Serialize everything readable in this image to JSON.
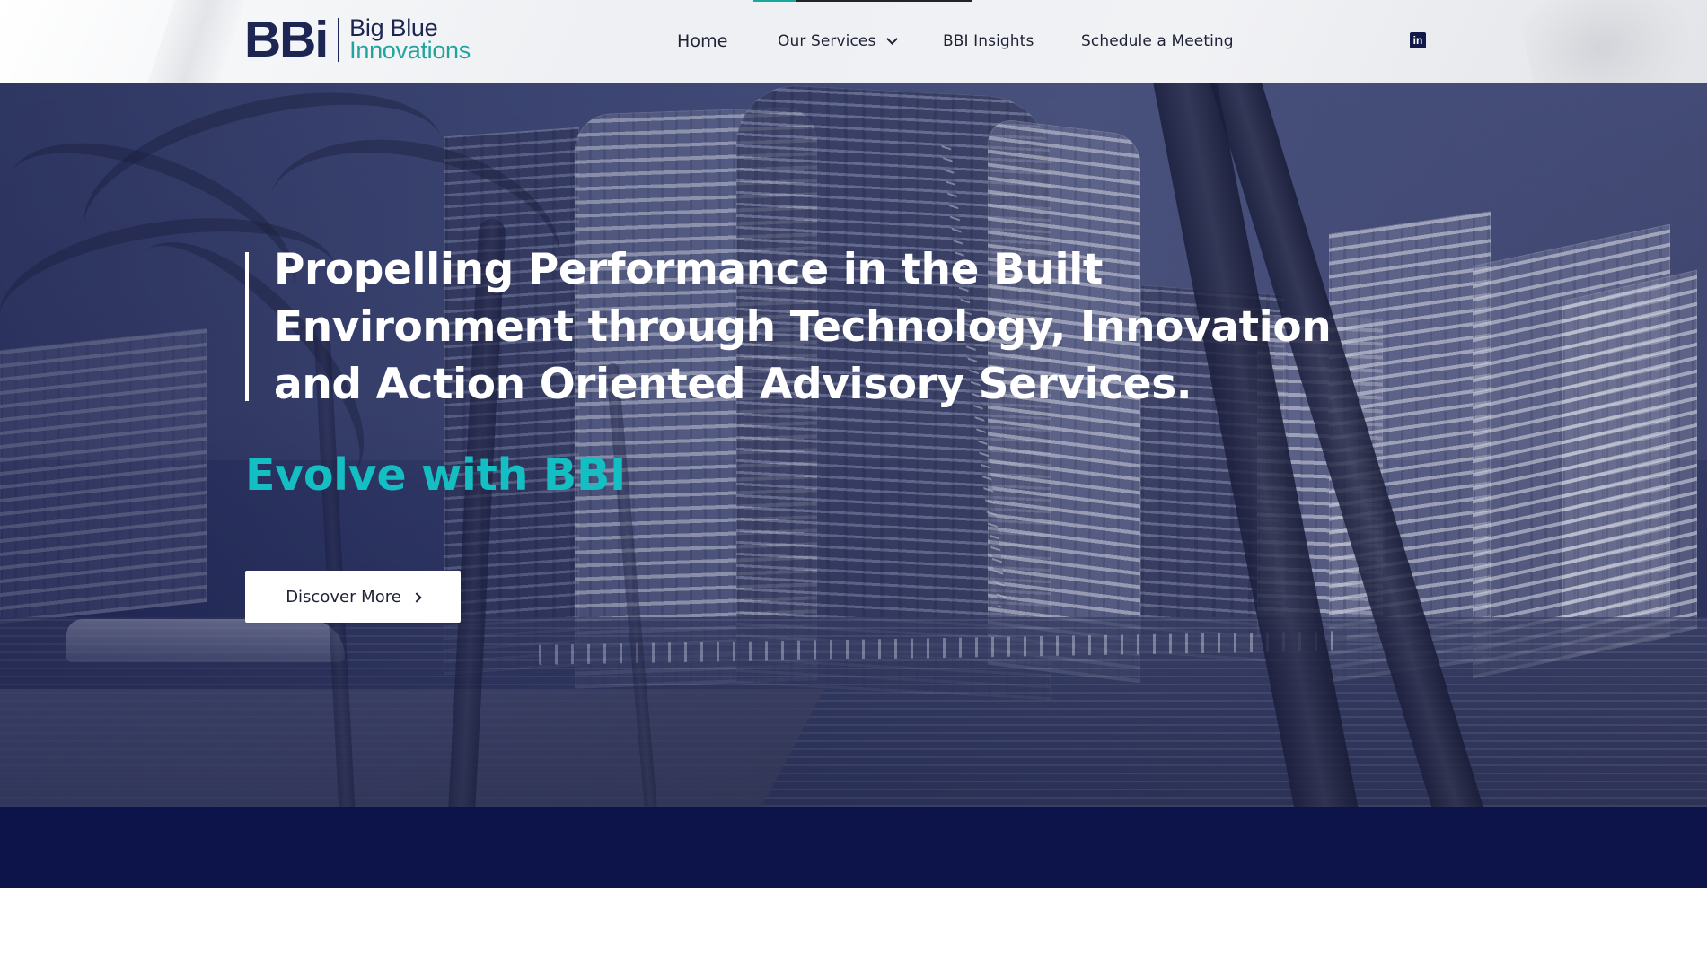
{
  "brand": {
    "logo_mark": "BBi",
    "name_line_1": "Big Blue",
    "name_line_2": "Innovations",
    "primary_color": "#1d2653",
    "secondary_color": "#1fa49e"
  },
  "navigation": {
    "items": [
      {
        "label": "Home"
      },
      {
        "label": "Our Services"
      },
      {
        "label": "BBI Insights"
      },
      {
        "label": "Schedule a Meeting"
      }
    ],
    "social_icon": "linkedin-icon",
    "social_label": "in"
  },
  "hero": {
    "headline": "Propelling Performance in the Built\nEnvironment through Technology, Innovation\nand Action Oriented Advisory Services.",
    "tagline": "Evolve with BBI",
    "cta_label": "Discover More",
    "cta_icon": "chevron-right-icon",
    "accent_color": "#14bfc4",
    "overlay_color": "#182066"
  },
  "footer_band": {
    "color": "#0c1449"
  }
}
